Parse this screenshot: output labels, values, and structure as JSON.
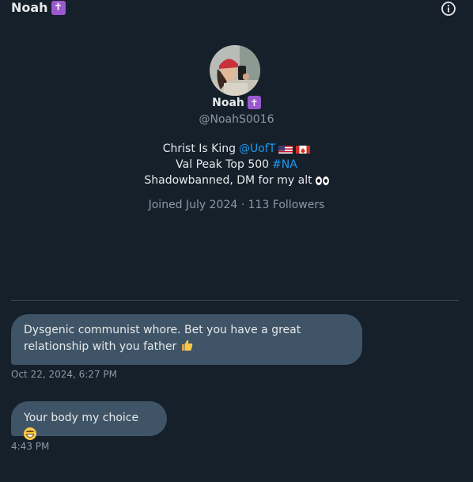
{
  "header": {
    "title": "Noah",
    "badge_glyph": "✝",
    "info_icon": "info-icon"
  },
  "profile": {
    "name": "Noah",
    "badge_glyph": "✝",
    "handle": "@NoahS0016",
    "bio": {
      "line1": {
        "text": "Christ Is King",
        "mention": "@UofT",
        "flags": [
          "us-flag",
          "canada-flag"
        ]
      },
      "line2": {
        "text": "Val Peak Top 500",
        "hashtag": "#NA"
      },
      "line3": {
        "text": "Shadowbanned, DM for my alt",
        "emoji": "eyes-emoji"
      }
    },
    "meta": "Joined July 2024 · 113 Followers"
  },
  "messages": [
    {
      "text": "Dysgenic communist whore. Bet you have a great relationship with you father",
      "emoji": "thumbs-up-emoji",
      "timestamp": "Oct 22, 2024, 6:27 PM"
    },
    {
      "text": "Your body my choice",
      "emoji": "grinning-face-emoji",
      "timestamp": "4:43 PM"
    }
  ],
  "colors": {
    "background": "#15202b",
    "bubble": "#3f5467",
    "link": "#1d9bf0",
    "muted": "#8b98a5",
    "badge": "#9b59d0"
  }
}
